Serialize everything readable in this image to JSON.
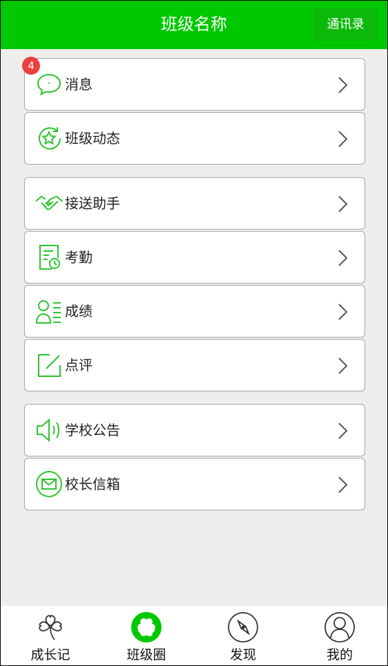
{
  "header": {
    "title": "班级名称",
    "contacts_label": "通讯录"
  },
  "menu": [
    {
      "label": "消息",
      "icon": "chat-bubble-icon",
      "badge": "4"
    },
    {
      "label": "班级动态",
      "icon": "star-refresh-icon"
    },
    {
      "label": "接送助手",
      "icon": "handshake-icon"
    },
    {
      "label": "考勤",
      "icon": "attendance-clock-icon"
    },
    {
      "label": "成绩",
      "icon": "user-list-icon"
    },
    {
      "label": "点评",
      "icon": "edit-square-icon"
    },
    {
      "label": "学校公告",
      "icon": "speaker-icon"
    },
    {
      "label": "校长信箱",
      "icon": "envelope-circle-icon"
    }
  ],
  "tabs": [
    {
      "label": "成长记",
      "icon": "clover-outline-icon"
    },
    {
      "label": "班级圈",
      "icon": "clover-filled-icon",
      "active": true
    },
    {
      "label": "发现",
      "icon": "compass-icon"
    },
    {
      "label": "我的",
      "icon": "person-circle-icon"
    }
  ],
  "colors": {
    "brand_green": "#00c800",
    "icon_green": "#2cc42c",
    "badge_red": "#e94040"
  }
}
